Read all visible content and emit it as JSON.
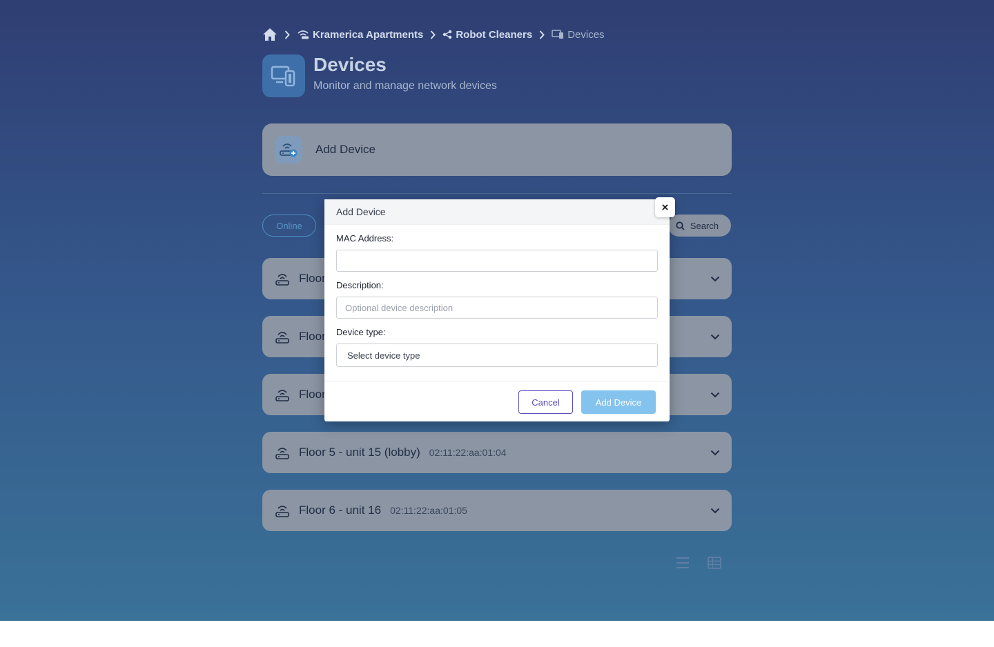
{
  "breadcrumb": {
    "items": [
      {
        "label": "Kramerica Apartments",
        "icon": "wifi-network-icon"
      },
      {
        "label": "Robot Cleaners",
        "icon": "share-nodes-icon"
      },
      {
        "label": "Devices",
        "icon": "devices-icon"
      }
    ]
  },
  "header": {
    "title": "Devices",
    "subtitle": "Monitor and manage network devices"
  },
  "add_card": {
    "label": "Add Device"
  },
  "filters": {
    "online_label": "Online",
    "search_label": "Search"
  },
  "devices": [
    {
      "name": "Floor",
      "mac": ""
    },
    {
      "name": "Floor",
      "mac": ""
    },
    {
      "name": "Floor",
      "mac": ""
    },
    {
      "name": "Floor 5 - unit 15 (lobby)",
      "mac": "02:11:22:aa:01:04"
    },
    {
      "name": "Floor 6 - unit 16",
      "mac": "02:11:22:aa:01:05"
    }
  ],
  "modal": {
    "title": "Add Device",
    "close_symbol": "×",
    "mac_label": "MAC Address:",
    "mac_value": "",
    "description_label": "Description:",
    "description_placeholder": "Optional device description",
    "type_label": "Device type:",
    "type_selected": "Select device type",
    "cancel_label": "Cancel",
    "submit_label": "Add Device"
  },
  "colors": {
    "accent": "#84c3ee",
    "cancel_border": "#5a4fb8",
    "background_top": "#2f3e73",
    "background_bottom": "#3a7298"
  }
}
